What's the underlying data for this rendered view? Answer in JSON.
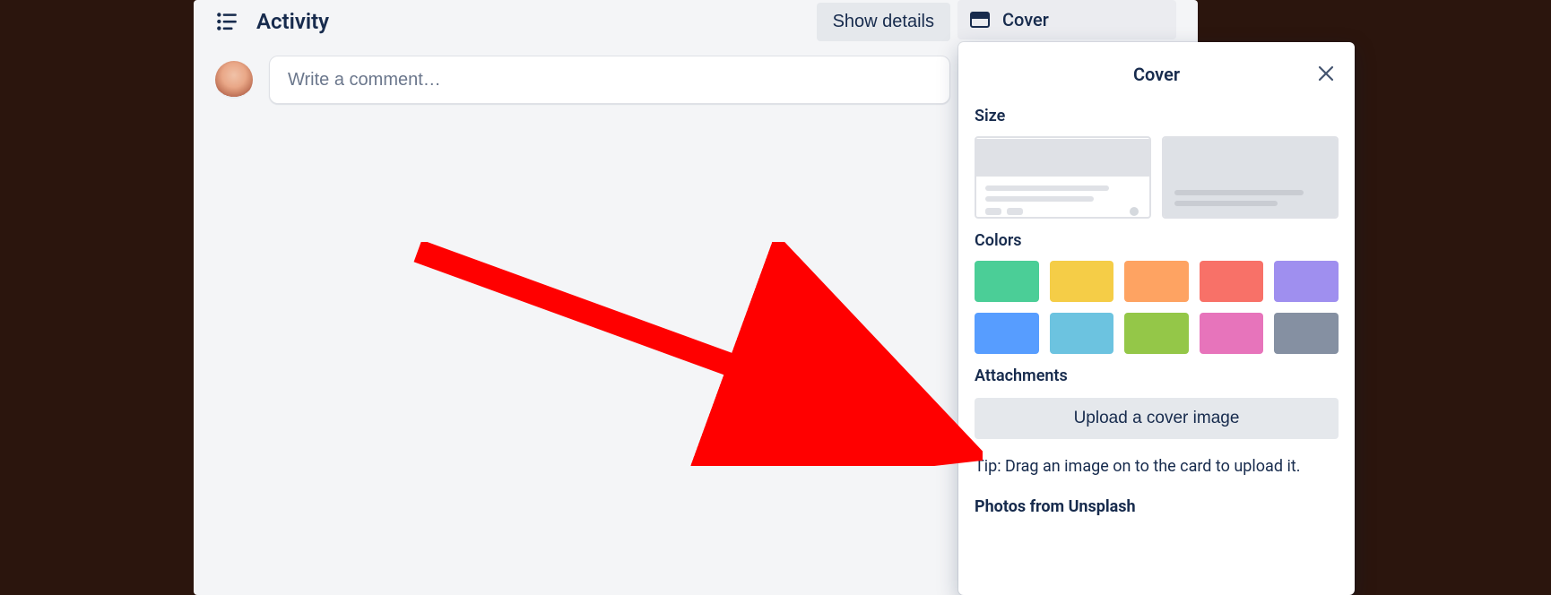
{
  "activity": {
    "title": "Activity",
    "show_details": "Show details",
    "comment_placeholder": "Write a comment…"
  },
  "sidebar": {
    "cover_label": "Cover"
  },
  "popover": {
    "title": "Cover",
    "size_label": "Size",
    "colors_label": "Colors",
    "attachments_label": "Attachments",
    "upload_label": "Upload a cover image",
    "tip": "Tip: Drag an image on to the card to upload it.",
    "photos_label": "Photos from Unsplash"
  },
  "colors": {
    "row": [
      "#4bce97",
      "#f5cd47",
      "#fea362",
      "#f87168",
      "#9f8fef",
      "#579dff",
      "#6cc3e0",
      "#94c748",
      "#e774bb",
      "#8590a2"
    ]
  }
}
